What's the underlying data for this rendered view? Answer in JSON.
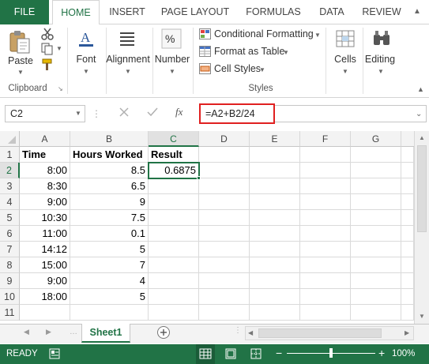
{
  "ribbon_tabs": [
    "FILE",
    "HOME",
    "INSERT",
    "PAGE LAYOUT",
    "FORMULAS",
    "DATA",
    "REVIEW"
  ],
  "active_tab": "HOME",
  "clipboard": {
    "paste_label": "Paste",
    "group_label": "Clipboard"
  },
  "font_group": {
    "label": "Font"
  },
  "alignment_group": {
    "label": "Alignment"
  },
  "number_group": {
    "label": "Number"
  },
  "styles": {
    "conditional_formatting": "Conditional Formatting",
    "format_as_table": "Format as Table",
    "cell_styles": "Cell Styles",
    "group_label": "Styles"
  },
  "cells_group": {
    "label": "Cells"
  },
  "editing_group": {
    "label": "Editing"
  },
  "formula_bar": {
    "name_box": "C2",
    "fx_label": "fx",
    "formula": "=A2+B2/24"
  },
  "grid": {
    "columns": [
      "A",
      "B",
      "C",
      "D",
      "E",
      "F",
      "G"
    ],
    "row_numbers": [
      "1",
      "2",
      "3",
      "4",
      "5",
      "6",
      "7",
      "8",
      "9",
      "10",
      "11"
    ],
    "headers": {
      "a": "Time",
      "b": "Hours Worked",
      "c": "Result"
    },
    "rows": [
      {
        "a": "8:00",
        "b": "8.5",
        "c": "0.6875"
      },
      {
        "a": "8:30",
        "b": "6.5",
        "c": ""
      },
      {
        "a": "9:00",
        "b": "9",
        "c": ""
      },
      {
        "a": "10:30",
        "b": "7.5",
        "c": ""
      },
      {
        "a": "11:00",
        "b": "0.1",
        "c": ""
      },
      {
        "a": "14:12",
        "b": "5",
        "c": ""
      },
      {
        "a": "15:00",
        "b": "7",
        "c": ""
      },
      {
        "a": "9:00",
        "b": "4",
        "c": ""
      },
      {
        "a": "18:00",
        "b": "5",
        "c": ""
      }
    ],
    "selected_cell": "C2"
  },
  "sheet_tabs": [
    "Sheet1"
  ],
  "status": {
    "ready": "READY",
    "zoom": "100%"
  },
  "colors": {
    "accent": "#217346",
    "highlight_box": "#e02020"
  }
}
